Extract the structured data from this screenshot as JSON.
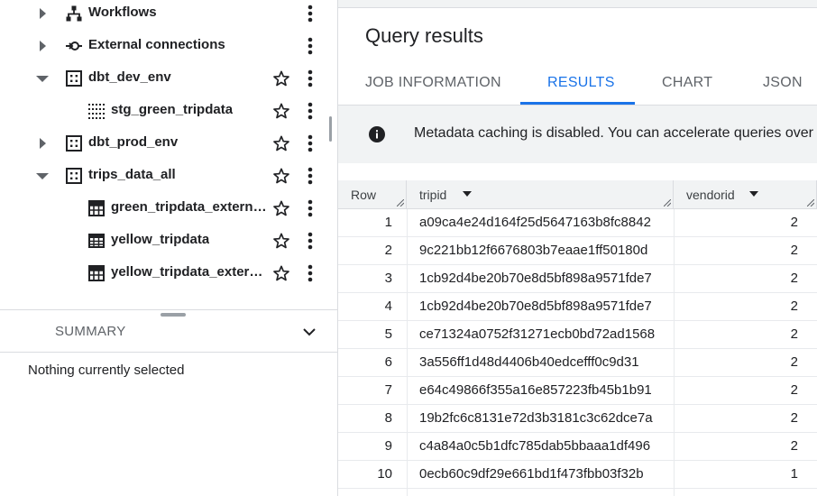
{
  "explorer": {
    "items": [
      {
        "label": "Workflows",
        "icon": "workflow-icon",
        "expand": "collapsed",
        "starred": false
      },
      {
        "label": "External connections",
        "icon": "external-connection-icon",
        "expand": "collapsed",
        "starred": false
      },
      {
        "label": "dbt_dev_env",
        "icon": "dataset-icon",
        "expand": "expanded",
        "starred": true
      },
      {
        "label": "stg_green_tripdata",
        "icon": "view-icon",
        "expand": "none",
        "starred": true
      },
      {
        "label": "dbt_prod_env",
        "icon": "dataset-icon",
        "expand": "collapsed",
        "starred": true
      },
      {
        "label": "trips_data_all",
        "icon": "dataset-icon",
        "expand": "expanded",
        "starred": true
      },
      {
        "label": "green_tripdata_external…",
        "icon": "external-table-icon",
        "expand": "none",
        "starred": true
      },
      {
        "label": "yellow_tripdata",
        "icon": "table-icon",
        "expand": "none",
        "starred": true
      },
      {
        "label": "yellow_tripdata_externa…",
        "icon": "external-table-icon",
        "expand": "none",
        "starred": true
      }
    ]
  },
  "summary": {
    "title": "SUMMARY",
    "empty_text": "Nothing currently selected"
  },
  "query": {
    "title": "Query results",
    "tabs": [
      "JOB INFORMATION",
      "RESULTS",
      "CHART",
      "JSON"
    ],
    "active_tab": "RESULTS",
    "banner": "Metadata caching is disabled. You can accelerate queries over"
  },
  "grid": {
    "columns": [
      "Row",
      "tripid",
      "vendorid"
    ],
    "rows": [
      {
        "row": "1",
        "tripid": "a09ca4e24d164f25d5647163b8fc8842",
        "vendorid": "2"
      },
      {
        "row": "2",
        "tripid": "9c221bb12f6676803b7eaae1ff50180d",
        "vendorid": "2"
      },
      {
        "row": "3",
        "tripid": "1cb92d4be20b70e8d5bf898a9571fde7",
        "vendorid": "2"
      },
      {
        "row": "4",
        "tripid": "1cb92d4be20b70e8d5bf898a9571fde7",
        "vendorid": "2"
      },
      {
        "row": "5",
        "tripid": "ce71324a0752f31271ecb0bd72ad1568",
        "vendorid": "2"
      },
      {
        "row": "6",
        "tripid": "3a556ff1d48d4406b40edcefff0c9d31",
        "vendorid": "2"
      },
      {
        "row": "7",
        "tripid": "e64c49866f355a16e857223fb45b1b91",
        "vendorid": "2"
      },
      {
        "row": "8",
        "tripid": "19b2fc6c8131e72d3b3181c3c62dce7a",
        "vendorid": "2"
      },
      {
        "row": "9",
        "tripid": "c4a84a0c5b1dfc785dab5bbaaa1df496",
        "vendorid": "2"
      },
      {
        "row": "10",
        "tripid": "0ecb60c9df29e661bd1f473fbb03f32b",
        "vendorid": "1"
      }
    ]
  },
  "colors": {
    "accent": "#1a73e8",
    "text": "#202124",
    "muted": "#5f6368",
    "divider": "#dadce0",
    "banner_bg": "#f1f3f4"
  }
}
